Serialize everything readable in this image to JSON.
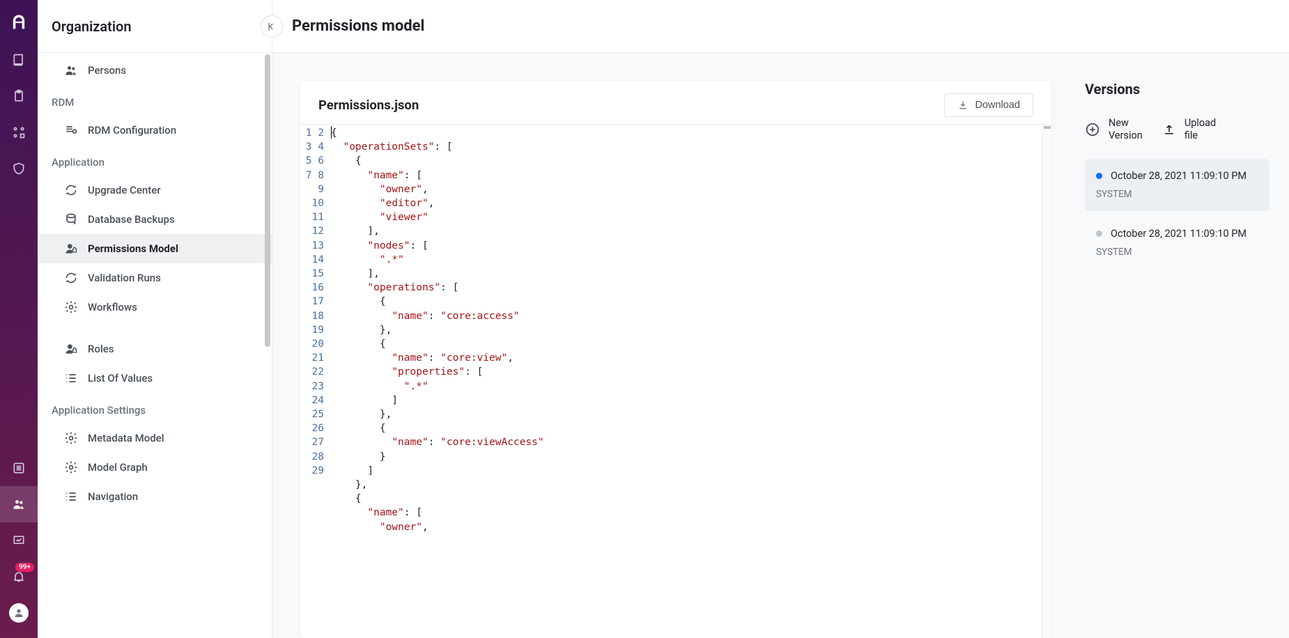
{
  "sidebar_title": "Organization",
  "page_title": "Permissions model",
  "nav": {
    "persons": "Persons",
    "section_rdm": "RDM",
    "rdm_config": "RDM Configuration",
    "section_app": "Application",
    "upgrade_center": "Upgrade Center",
    "db_backups": "Database Backups",
    "permissions_model": "Permissions Model",
    "validation_runs": "Validation Runs",
    "workflows": "Workflows",
    "roles": "Roles",
    "lov": "List Of Values",
    "section_settings": "Application Settings",
    "metadata_model": "Metadata Model",
    "model_graph": "Model Graph",
    "navigation": "Navigation"
  },
  "editor": {
    "filename": "Permissions.json",
    "download": "Download",
    "line_count": 29,
    "tokens": [
      [
        [
          "{",
          "pun"
        ]
      ],
      [
        [
          "  ",
          ""
        ],
        [
          "\"operationSets\"",
          "str"
        ],
        [
          ": [",
          "pun"
        ]
      ],
      [
        [
          "    {",
          "pun"
        ]
      ],
      [
        [
          "      ",
          ""
        ],
        [
          "\"name\"",
          "str"
        ],
        [
          ": [",
          "pun"
        ]
      ],
      [
        [
          "        ",
          ""
        ],
        [
          "\"owner\"",
          "str"
        ],
        [
          ",",
          "pun"
        ]
      ],
      [
        [
          "        ",
          ""
        ],
        [
          "\"editor\"",
          "str"
        ],
        [
          ",",
          "pun"
        ]
      ],
      [
        [
          "        ",
          ""
        ],
        [
          "\"viewer\"",
          "str"
        ]
      ],
      [
        [
          "      ],",
          "pun"
        ]
      ],
      [
        [
          "      ",
          ""
        ],
        [
          "\"nodes\"",
          "str"
        ],
        [
          ": [",
          "pun"
        ]
      ],
      [
        [
          "        ",
          ""
        ],
        [
          "\".*\"",
          "str"
        ]
      ],
      [
        [
          "      ],",
          "pun"
        ]
      ],
      [
        [
          "      ",
          ""
        ],
        [
          "\"operations\"",
          "str"
        ],
        [
          ": [",
          "pun"
        ]
      ],
      [
        [
          "        {",
          "pun"
        ]
      ],
      [
        [
          "          ",
          ""
        ],
        [
          "\"name\"",
          "str"
        ],
        [
          ": ",
          "pun"
        ],
        [
          "\"core:access\"",
          "str"
        ]
      ],
      [
        [
          "        },",
          "pun"
        ]
      ],
      [
        [
          "        {",
          "pun"
        ]
      ],
      [
        [
          "          ",
          ""
        ],
        [
          "\"name\"",
          "str"
        ],
        [
          ": ",
          "pun"
        ],
        [
          "\"core:view\"",
          "str"
        ],
        [
          ",",
          "pun"
        ]
      ],
      [
        [
          "          ",
          ""
        ],
        [
          "\"properties\"",
          "str"
        ],
        [
          ": [",
          "pun"
        ]
      ],
      [
        [
          "            ",
          ""
        ],
        [
          "\".*\"",
          "str"
        ]
      ],
      [
        [
          "          ]",
          "pun"
        ]
      ],
      [
        [
          "        },",
          "pun"
        ]
      ],
      [
        [
          "        {",
          "pun"
        ]
      ],
      [
        [
          "          ",
          ""
        ],
        [
          "\"name\"",
          "str"
        ],
        [
          ": ",
          "pun"
        ],
        [
          "\"core:viewAccess\"",
          "str"
        ]
      ],
      [
        [
          "        }",
          "pun"
        ]
      ],
      [
        [
          "      ]",
          "pun"
        ]
      ],
      [
        [
          "    },",
          "pun"
        ]
      ],
      [
        [
          "    {",
          "pun"
        ]
      ],
      [
        [
          "      ",
          ""
        ],
        [
          "\"name\"",
          "str"
        ],
        [
          ": [",
          "pun"
        ]
      ],
      [
        [
          "        ",
          ""
        ],
        [
          "\"owner\"",
          "str"
        ],
        [
          ",",
          "pun"
        ]
      ]
    ]
  },
  "versions": {
    "title": "Versions",
    "new_version": "New<br>Version",
    "upload_file": "Upload<br>file",
    "items": [
      {
        "active": true,
        "ts": "October 28, 2021 11:09:10 PM",
        "author": "SYSTEM"
      },
      {
        "active": false,
        "ts": "October 28, 2021 11:09:10 PM",
        "author": "SYSTEM"
      }
    ]
  },
  "badge": "99+"
}
